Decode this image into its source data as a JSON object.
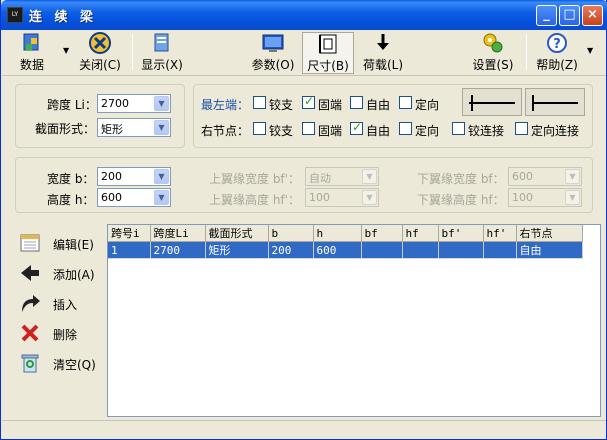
{
  "window": {
    "title": "连 续 梁"
  },
  "titlebar_buttons": [
    "_",
    "□",
    "×"
  ],
  "toolbar": {
    "data": "数据",
    "close": "关闭(C)",
    "show": "显示(X)",
    "params": "参数(O)",
    "size": "尺寸(B)",
    "load": "荷载(L)",
    "settings": "设置(S)",
    "help": "帮助(Z)"
  },
  "span_group": {
    "span_label": "跨度 Li：",
    "span_value": "2700",
    "section_label": "截面形式：",
    "section_value": "矩形"
  },
  "support_group": {
    "left_label": "最左端：",
    "right_label": "右节点：",
    "options": [
      "铰支",
      "固端",
      "自由",
      "定向"
    ],
    "left_checked": [
      false,
      true,
      false,
      false
    ],
    "right_checked": [
      false,
      false,
      true,
      false
    ],
    "right_extra": [
      "铰连接",
      "定向连接"
    ],
    "right_extra_checked": [
      false,
      false
    ]
  },
  "dims_group": {
    "width_label": "宽度 b：",
    "width_value": "200",
    "height_label": "高度 h：",
    "height_value": "600",
    "top_flange_width_label": "上翼缘宽度 bf'：",
    "top_flange_width_value": "自动",
    "top_flange_height_label": "上翼缘高度 hf'：",
    "top_flange_height_value": "100",
    "bottom_flange_width_label": "下翼缘宽度 bf：",
    "bottom_flange_width_value": "600",
    "bottom_flange_height_label": "下翼缘高度 hf：",
    "bottom_flange_height_value": "100"
  },
  "side_buttons": {
    "edit": "编辑(E)",
    "add": "添加(A)",
    "insert": "插入",
    "delete": "删除",
    "clear": "清空(Q)"
  },
  "table": {
    "headers": [
      "跨号i",
      "跨度Li",
      "截面形式",
      "b",
      "h",
      "bf",
      "hf",
      "bf'",
      "hf'",
      "右节点"
    ],
    "rows": [
      [
        "1",
        "2700",
        "矩形",
        "200",
        "600",
        "",
        "",
        "",
        "",
        "自由"
      ]
    ]
  }
}
